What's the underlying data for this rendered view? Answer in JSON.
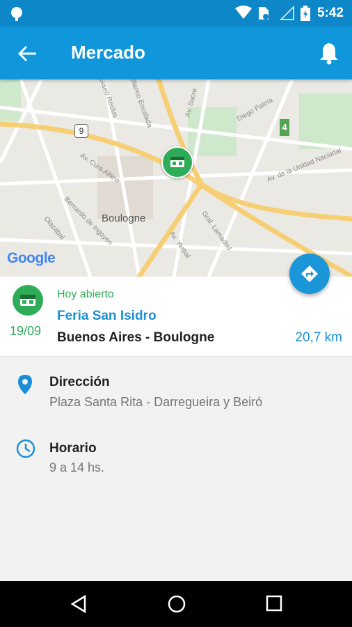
{
  "status_bar": {
    "time": "5:42"
  },
  "app_bar": {
    "title": "Mercado"
  },
  "map": {
    "area_label": "Boulogne",
    "attribution": "Google",
    "route_marker": "9",
    "park_marker": "4",
    "streets": [
      "Eliseo Reclus",
      "Blanco Encalada",
      "Av. Sucre",
      "Diego Palma",
      "Av. de la Unidad Nacional",
      "Av. Cura Allievi",
      "Bernardo de Irigoyen",
      "Olazábal",
      "Av. Yerbal",
      "Gral. Lamadrid"
    ]
  },
  "market": {
    "status": "Hoy abierto",
    "name": "Feria San Isidro",
    "location": "Buenos Aires - Boulogne",
    "distance": "20,7 km",
    "date": "19/09"
  },
  "details": {
    "address_label": "Dirección",
    "address_value": "Plaza Santa Rita - Darregueira y Beiró",
    "hours_label": "Horario",
    "hours_value": "9 a 14 hs."
  },
  "colors": {
    "primary": "#0f96db",
    "green": "#2eac58",
    "link": "#1a8fd6"
  }
}
